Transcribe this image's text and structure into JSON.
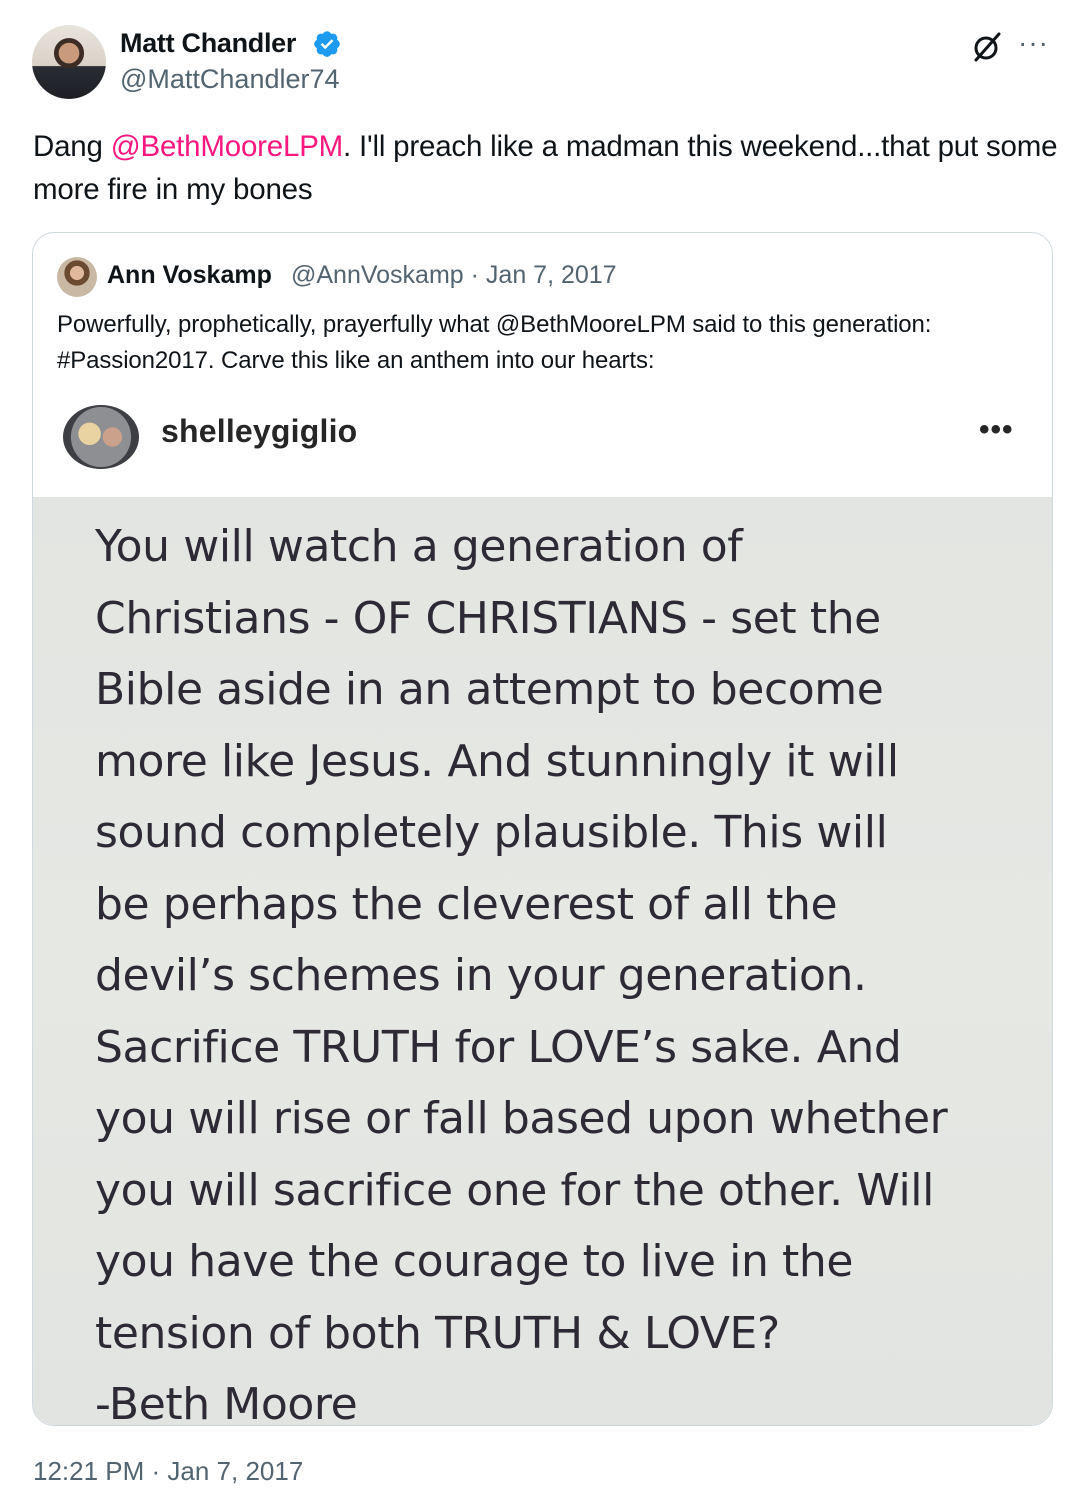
{
  "author": {
    "name": "Matt Chandler",
    "handle": "@MattChandler74"
  },
  "tweet": {
    "text_before": "Dang ",
    "mention": "@BethMooreLPM",
    "text_after": ".  I'll preach like a madman this weekend...that put some more fire in my bones",
    "timestamp": "12:21 PM · Jan 7, 2017"
  },
  "quoted": {
    "name": "Ann Voskamp",
    "meta": "@AnnVoskamp · Jan 7, 2017",
    "text": "Powerfully, prophetically, prayerfully what @BethMooreLPM said to this generation: #Passion2017. Carve this like an anthem into our hearts:",
    "image": {
      "username": "shelleygiglio",
      "more": "•••",
      "lines": [
        "You will watch a generation of",
        "Christians - OF CHRISTIANS - set the",
        "Bible aside in an attempt to become",
        "more like Jesus. And stunningly it will",
        "sound completely plausible. This will",
        "be perhaps the cleverest of all the",
        "devil’s schemes in your generation.",
        "Sacrifice TRUTH for LOVE’s sake. And",
        "you will rise or fall based upon whether",
        "you will sacrifice one for the other. Will",
        "you have the courage to live in the",
        "tension of both TRUTH & LOVE?",
        "-Beth Moore"
      ]
    }
  },
  "icons": {
    "verified": "verified-badge-icon",
    "grok": "grok-icon",
    "more": "more-options-icon"
  },
  "colors": {
    "mention": "#f91880",
    "verified": "#1d9bf0",
    "secondary_text": "#536471"
  }
}
